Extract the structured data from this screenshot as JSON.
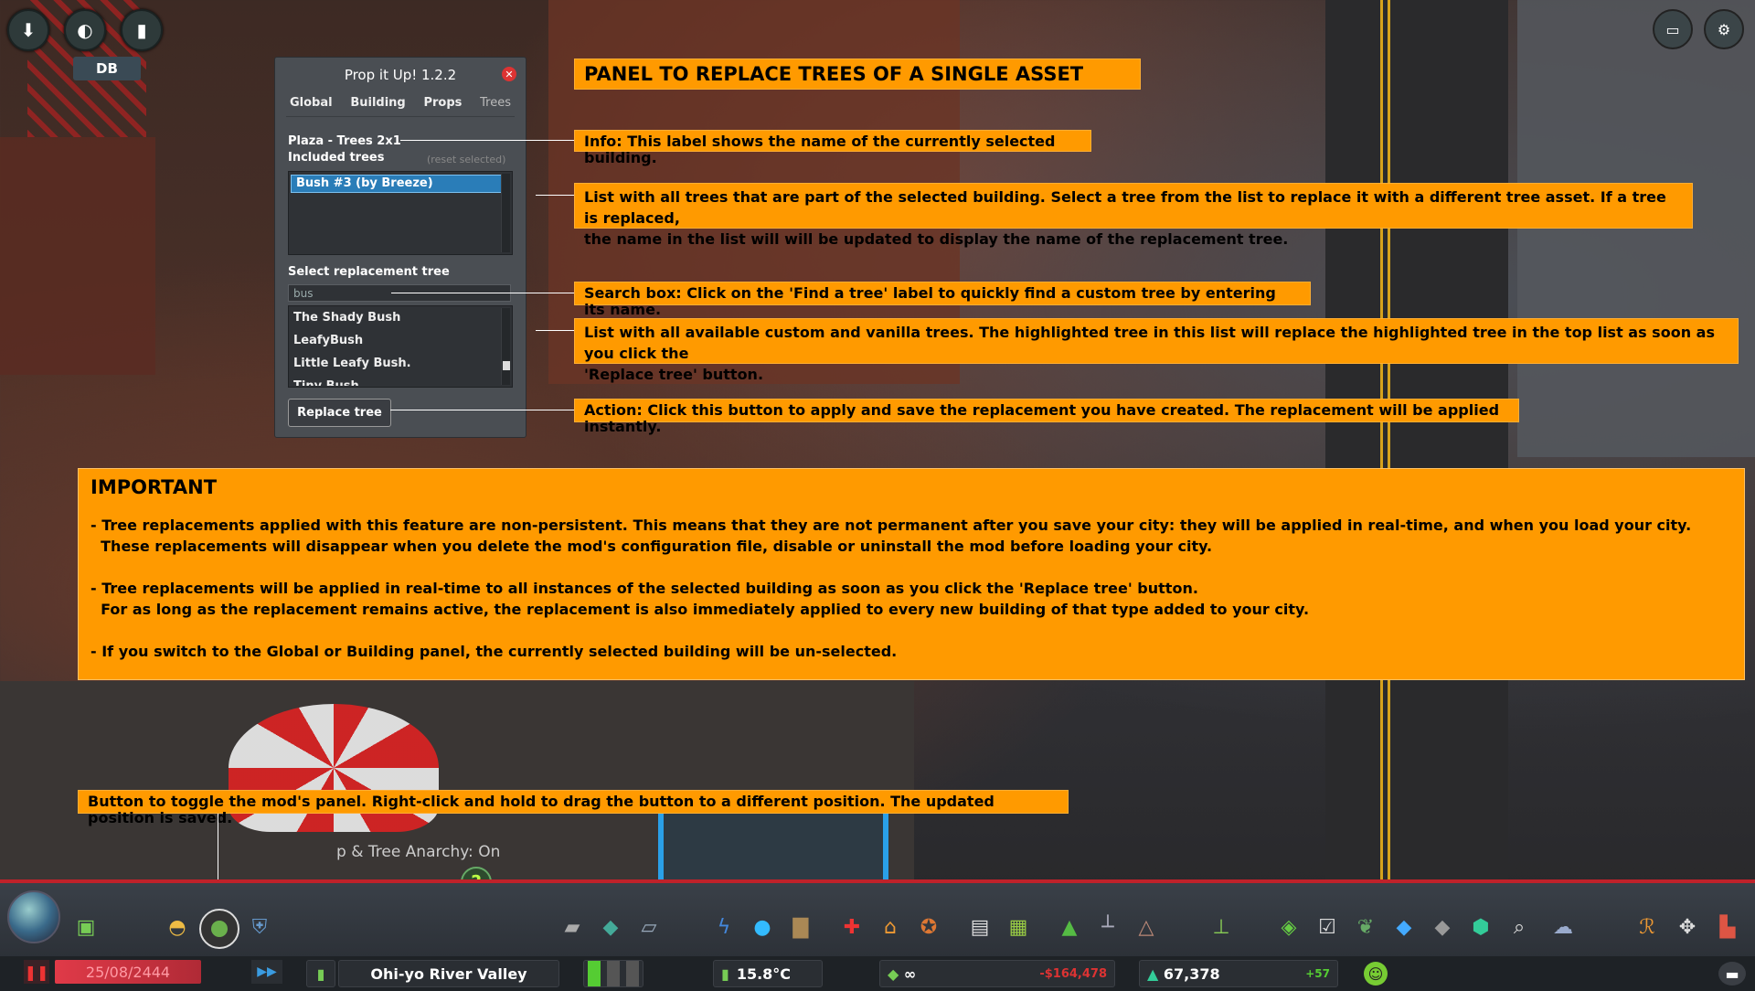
{
  "hud": {
    "db_label": "DB"
  },
  "panel": {
    "title": "Prop it Up! 1.2.2",
    "tabs": [
      "Global",
      "Building",
      "Props",
      "Trees"
    ],
    "building_name": "Plaza - Trees 2x1",
    "included_trees_label": "Included trees",
    "reset_selected_label": "(reset selected)",
    "included_trees": [
      "Bush #3 (by Breeze)"
    ],
    "select_replacement_label": "Select replacement tree",
    "search_value": "bus",
    "available_trees": [
      "The Shady Bush",
      "LeafyBush",
      "Little Leafy Bush.",
      "Tiny Bush"
    ],
    "replace_button": "Replace tree"
  },
  "callouts": {
    "heading": "PANEL TO REPLACE TREES OF A SINGLE ASSET",
    "info": "Info: This label shows the name of the currently selected building.",
    "list_top_1": "List with all trees that are part of the selected building. Select a tree from the list to replace it with a different tree asset. If a tree is replaced,",
    "list_top_2": "the name in the list will will be updated to display the name of the replacement tree.",
    "search": "Search box: Click on the 'Find a tree' label to quickly find a custom tree by entering its name.",
    "list_bottom_1": "List with all available custom and vanilla trees. The highlighted tree in this list will replace the highlighted tree in the top list as soon as you click the",
    "list_bottom_2": "'Replace tree' button.",
    "action": "Action: Click this button to apply and save the replacement you have created. The replacement will be applied instantly.",
    "toggle": "Button to toggle the mod's panel. Right-click and hold to drag the button to a different position. The updated position is saved."
  },
  "important": {
    "title": "IMPORTANT",
    "p1_l1": "- Tree replacements applied with this feature are non-persistent. This means that they are not permanent after you save your city: they will be applied in real-time, and when you load your city.",
    "p1_l2": "  These replacements will disappear when you delete the mod's configuration file, disable or uninstall the mod before loading your city.",
    "p2_l1": "- Tree replacements will be applied in real-time to all instances of the selected building as soon as you click the 'Replace tree' button.",
    "p2_l2": "  For as long as the replacement remains active, the replacement is also immediately applied to every new building of that type added to your city.",
    "p3_l1": "- If you switch to the Global or Building panel, the currently selected building will be un-selected."
  },
  "scene": {
    "anarchy_text": "p & Tree Anarchy: On",
    "help_glyph": "?"
  },
  "status_bar": {
    "date": "25/08/2444",
    "city_name": "Ohi-yo River Valley",
    "temperature": "15.8°C",
    "money_symbol": "∞",
    "money_delta": "-$164,478",
    "population": "67,378",
    "population_delta": "+57"
  },
  "colors": {
    "callout_bg": "#ff9a00",
    "panel_bg": "#4a4e53",
    "selection": "#2a7db8",
    "toolbar_accent": "#c0222a"
  },
  "icons": {
    "toolbar": [
      "roads-icon",
      "zoning-icon",
      "districts-icon",
      "electricity-icon",
      "water-icon",
      "garbage-icon",
      "healthcare-icon",
      "fire-icon",
      "police-icon",
      "education-icon",
      "transport-icon",
      "parks-icon",
      "monuments-icon",
      "landscaping-icon",
      "terrain-icon",
      "unique-icon",
      "policies-icon",
      "info-icon",
      "layers-icon",
      "area-icon",
      "search-icon",
      "weather-icon"
    ]
  }
}
